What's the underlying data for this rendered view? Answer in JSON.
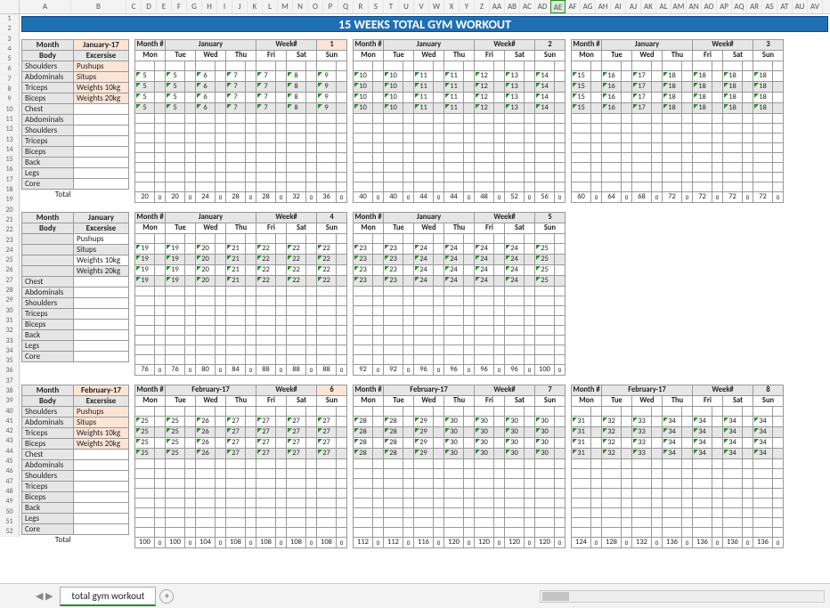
{
  "title": "15 WEEKS TOTAL GYM WORKOUT",
  "columns": [
    "A",
    "B",
    "C",
    "D",
    "E",
    "F",
    "G",
    "H",
    "I",
    "J",
    "K",
    "L",
    "M",
    "N",
    "O",
    "P",
    "Q",
    "R",
    "S",
    "T",
    "U",
    "V",
    "W",
    "X",
    "Y",
    "Z",
    "AA",
    "AB",
    "AC",
    "AD",
    "AE",
    "AF",
    "AG",
    "AH",
    "AI",
    "AJ",
    "AK",
    "AL",
    "AM",
    "AN",
    "AO",
    "AP",
    "AQ",
    "AR",
    "AS",
    "AT",
    "AU",
    "AV"
  ],
  "selected_col": "AE",
  "days": [
    "Mon",
    "Tue",
    "Wed",
    "Thu",
    "Fri",
    "Sat",
    "Sun"
  ],
  "labels": {
    "month_hash": "Month #",
    "week_hash": "Week#",
    "month": "Month",
    "body": "Body",
    "excersise": "Excersise",
    "total": "Total"
  },
  "body_parts_full": [
    "Shoulders",
    "Abdominals",
    "Triceps",
    "Biceps",
    "Chest",
    "Abdominals",
    "Shoulders",
    "Triceps",
    "Biceps",
    "Back",
    "Legs",
    "Core"
  ],
  "body_parts_short": [
    "",
    "",
    "",
    "",
    "Chest",
    "Abdominals",
    "Shoulders",
    "Triceps",
    "Biceps",
    "Back",
    "Legs",
    "Core"
  ],
  "exercises": [
    "Pushups",
    "Situps",
    "Weights 10kg",
    "Weights 20kg"
  ],
  "months": {
    "jan17": "January-17",
    "jan": "January",
    "feb17": "February-17",
    "feb": "February"
  },
  "weeks": {
    "w1": {
      "month": "January",
      "num": "1",
      "vals": [
        [
          "5",
          "5",
          "6",
          "7",
          "7",
          "8",
          "9"
        ],
        [
          "5",
          "5",
          "6",
          "7",
          "7",
          "8",
          "9"
        ],
        [
          "5",
          "5",
          "6",
          "7",
          "7",
          "8",
          "9"
        ],
        [
          "5",
          "5",
          "6",
          "7",
          "7",
          "8",
          "9"
        ]
      ],
      "totals": [
        "20",
        "20",
        "24",
        "28",
        "28",
        "32",
        "36"
      ],
      "peach_num": true
    },
    "w2": {
      "month": "January",
      "num": "2",
      "vals": [
        [
          "10",
          "10",
          "11",
          "11",
          "12",
          "13",
          "14"
        ],
        [
          "10",
          "10",
          "11",
          "11",
          "12",
          "13",
          "14"
        ],
        [
          "10",
          "10",
          "11",
          "11",
          "12",
          "13",
          "14"
        ],
        [
          "10",
          "10",
          "11",
          "11",
          "12",
          "13",
          "14"
        ]
      ],
      "totals": [
        "40",
        "40",
        "44",
        "44",
        "48",
        "52",
        "56"
      ]
    },
    "w3": {
      "month": "January",
      "num": "3",
      "vals": [
        [
          "15",
          "16",
          "17",
          "18",
          "18",
          "18",
          "18"
        ],
        [
          "15",
          "16",
          "17",
          "18",
          "18",
          "18",
          "18"
        ],
        [
          "15",
          "16",
          "17",
          "18",
          "18",
          "18",
          "18"
        ],
        [
          "15",
          "16",
          "17",
          "18",
          "18",
          "18",
          "18"
        ]
      ],
      "totals": [
        "60",
        "64",
        "68",
        "72",
        "72",
        "72",
        "72"
      ]
    },
    "w4": {
      "month": "January",
      "num": "4",
      "vals": [
        [
          "19",
          "19",
          "20",
          "21",
          "22",
          "22",
          "22"
        ],
        [
          "19",
          "19",
          "20",
          "21",
          "22",
          "22",
          "22"
        ],
        [
          "19",
          "19",
          "20",
          "21",
          "22",
          "22",
          "22"
        ],
        [
          "19",
          "19",
          "20",
          "21",
          "22",
          "22",
          "22"
        ]
      ],
      "totals": [
        "76",
        "76",
        "80",
        "84",
        "88",
        "88",
        "88"
      ]
    },
    "w5": {
      "month": "January",
      "num": "5",
      "vals": [
        [
          "23",
          "23",
          "24",
          "24",
          "24",
          "24",
          "25"
        ],
        [
          "23",
          "23",
          "24",
          "24",
          "24",
          "24",
          "25"
        ],
        [
          "23",
          "23",
          "24",
          "24",
          "24",
          "24",
          "25"
        ],
        [
          "23",
          "23",
          "24",
          "24",
          "24",
          "24",
          "25"
        ]
      ],
      "totals": [
        "92",
        "92",
        "96",
        "96",
        "96",
        "96",
        "100"
      ]
    },
    "w6": {
      "month": "February-17",
      "num": "6",
      "vals": [
        [
          "25",
          "25",
          "26",
          "27",
          "27",
          "27",
          "27"
        ],
        [
          "25",
          "25",
          "26",
          "27",
          "27",
          "27",
          "27"
        ],
        [
          "25",
          "25",
          "26",
          "27",
          "27",
          "27",
          "27"
        ],
        [
          "25",
          "25",
          "26",
          "27",
          "27",
          "27",
          "27"
        ]
      ],
      "totals": [
        "100",
        "100",
        "104",
        "108",
        "108",
        "108",
        "108"
      ],
      "peach_num": true
    },
    "w7": {
      "month": "February-17",
      "num": "7",
      "vals": [
        [
          "28",
          "28",
          "29",
          "30",
          "30",
          "30",
          "30"
        ],
        [
          "28",
          "28",
          "29",
          "30",
          "30",
          "30",
          "30"
        ],
        [
          "28",
          "28",
          "29",
          "30",
          "30",
          "30",
          "30"
        ],
        [
          "28",
          "28",
          "29",
          "30",
          "30",
          "30",
          "30"
        ]
      ],
      "totals": [
        "112",
        "112",
        "116",
        "120",
        "120",
        "120",
        "120"
      ]
    },
    "w8": {
      "month": "February-17",
      "num": "8",
      "vals": [
        [
          "31",
          "32",
          "33",
          "34",
          "34",
          "34",
          "34"
        ],
        [
          "31",
          "32",
          "33",
          "34",
          "34",
          "34",
          "34"
        ],
        [
          "31",
          "32",
          "33",
          "34",
          "34",
          "34",
          "34"
        ],
        [
          "31",
          "32",
          "33",
          "34",
          "34",
          "34",
          "34"
        ]
      ],
      "totals": [
        "124",
        "128",
        "132",
        "136",
        "136",
        "136",
        "136"
      ]
    }
  },
  "sheet_tab": "total gym workout",
  "plus": "+",
  "nav_arrows": "◀ ▶"
}
